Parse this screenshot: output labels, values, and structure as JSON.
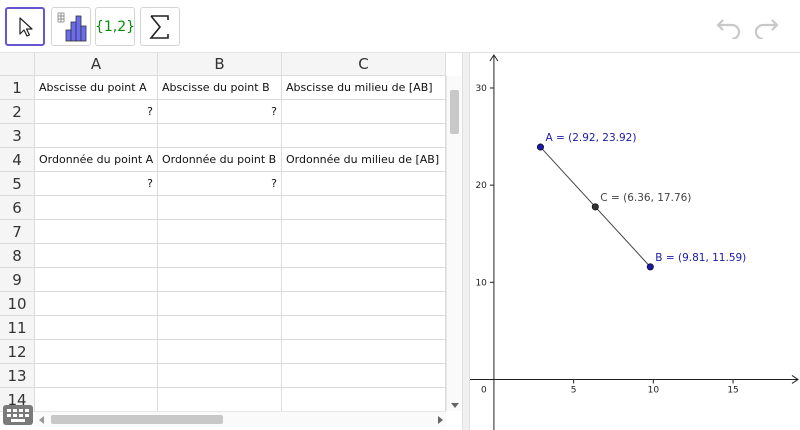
{
  "toolbar": {
    "tools": [
      {
        "name": "move-tool",
        "label": "",
        "icon": "cursor-arrow-icon",
        "selected": true
      },
      {
        "name": "one-variable-analysis-tool",
        "label": "",
        "icon": "histogram-icon",
        "selected": false
      },
      {
        "name": "create-list-tool",
        "label": "{1,2}",
        "icon": "list-braces-icon",
        "selected": false
      },
      {
        "name": "sum-tool",
        "label": "",
        "icon": "sigma-icon",
        "selected": false
      }
    ],
    "undo_icon": "undo-icon",
    "redo_icon": "redo-icon"
  },
  "spreadsheet": {
    "columns": [
      "A",
      "B",
      "C"
    ],
    "rows": [
      [
        "Abscisse du point A",
        "Abscisse du point B",
        "Abscisse du milieu de [AB]"
      ],
      [
        "?",
        "?",
        ""
      ],
      [
        "",
        "",
        ""
      ],
      [
        "Ordonnée du point A",
        "Ordonnée du point B",
        "Ordonnée du milieu de [AB]"
      ],
      [
        "?",
        "?",
        ""
      ],
      [
        "",
        "",
        ""
      ],
      [
        "",
        "",
        ""
      ],
      [
        "",
        "",
        ""
      ],
      [
        "",
        "",
        ""
      ],
      [
        "",
        "",
        ""
      ],
      [
        "",
        "",
        ""
      ],
      [
        "",
        "",
        ""
      ],
      [
        "",
        "",
        ""
      ],
      [
        "",
        "",
        ""
      ]
    ],
    "row_labels": [
      "1",
      "2",
      "3",
      "4",
      "5",
      "6",
      "7",
      "8",
      "9",
      "10",
      "11",
      "12",
      "13",
      "14"
    ]
  },
  "graphics": {
    "x_ticks": [
      0,
      5,
      10,
      15
    ],
    "y_ticks": [
      10,
      20,
      30
    ],
    "x_range": [
      -1.5,
      19.2
    ],
    "y_range": [
      -5.2,
      33.6
    ],
    "points": [
      {
        "name": "A",
        "label": "A = (2.92, 23.92)",
        "x": 2.92,
        "y": 23.92,
        "color": "#1a1aaa"
      },
      {
        "name": "B",
        "label": "B = (9.81, 11.59)",
        "x": 9.81,
        "y": 11.59,
        "color": "#1a1aaa"
      },
      {
        "name": "C",
        "label": "C = (6.36, 17.76)",
        "x": 6.36,
        "y": 17.76,
        "color": "#333333"
      }
    ],
    "segment": {
      "from": "A",
      "to": "B",
      "color": "#444444"
    }
  },
  "colors": {
    "accent": "#6557d2",
    "point_blue": "#1a1aaa",
    "point_dark": "#333333"
  }
}
